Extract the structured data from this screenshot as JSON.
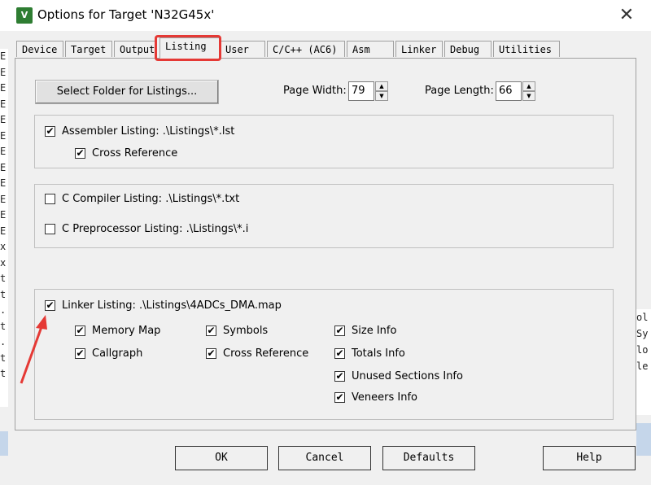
{
  "window": {
    "title": "Options for Target 'N32G45x'",
    "app_icon_label": "V",
    "close_glyph": "✕"
  },
  "background": {
    "left_chars": [
      "E",
      "E",
      "E",
      "E",
      "E",
      "E",
      "E",
      "E",
      "E",
      "E",
      "E",
      "E",
      "x",
      "x",
      "t",
      "t",
      ".",
      "t",
      ".",
      "t",
      "t"
    ],
    "right_chars": [
      "ol",
      "Sy",
      "lo",
      "le"
    ]
  },
  "tabs": [
    {
      "label": "Device"
    },
    {
      "label": "Target"
    },
    {
      "label": "Output"
    },
    {
      "label": "Listing"
    },
    {
      "label": "User"
    },
    {
      "label": "C/C++ (AC6)"
    },
    {
      "label": "Asm"
    },
    {
      "label": "Linker"
    },
    {
      "label": "Debug"
    },
    {
      "label": "Utilities"
    }
  ],
  "toolbar": {
    "select_folder_label": "Select Folder for Listings...",
    "page_width_label": "Page Width:",
    "page_width_value": "79",
    "page_length_label": "Page Length:",
    "page_length_value": "66"
  },
  "assembler": {
    "listing_label": "Assembler Listing:  .\\Listings\\*.lst",
    "listing_checked": "✔",
    "cross_ref_label": "Cross Reference",
    "cross_ref_checked": "✔"
  },
  "compiler": {
    "c_listing_label": "C Compiler Listing:  .\\Listings\\*.txt",
    "preproc_label": "C Preprocessor Listing:  .\\Listings\\*.i"
  },
  "linker": {
    "listing_label": "Linker Listing:  .\\Listings\\4ADCs_DMA.map",
    "check": "✔",
    "memory_map": "Memory Map",
    "callgraph": "Callgraph",
    "symbols": "Symbols",
    "cross_reference": "Cross Reference",
    "size_info": "Size Info",
    "totals_info": "Totals Info",
    "unused_sections": "Unused Sections Info",
    "veneers_info": "Veneers Info"
  },
  "buttons": {
    "ok": "OK",
    "cancel": "Cancel",
    "defaults": "Defaults",
    "help": "Help"
  },
  "colors": {
    "highlight": "#e53935",
    "arrow": "#e53935"
  }
}
